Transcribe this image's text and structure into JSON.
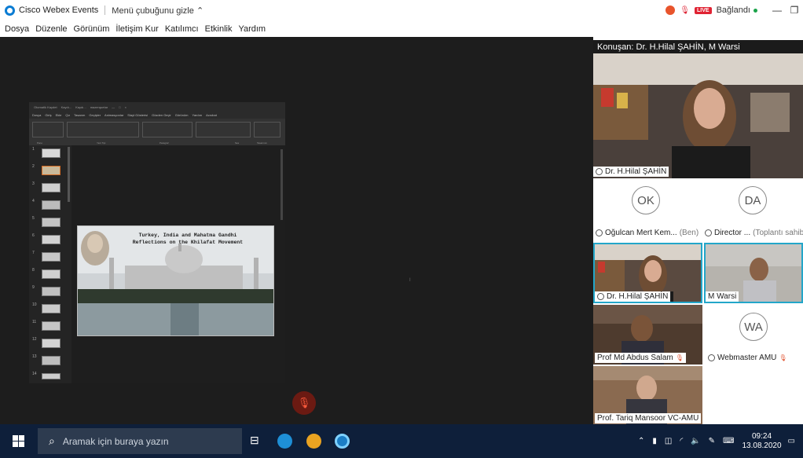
{
  "titlebar": {
    "app_title": "Cisco Webex Events",
    "hide_menu": "Menü çubuğunu gizle",
    "live": "LIVE",
    "connection": "Bağlandı",
    "minimize": "—",
    "restore": "❐"
  },
  "menu": {
    "items": [
      "Dosya",
      "Düzenle",
      "Görünüm",
      "İletişim Kur",
      "Katılımcı",
      "Etkinlik",
      "Yardım"
    ]
  },
  "ppt": {
    "top_items": [
      "Otomatik Kaydet",
      "Kaydı...",
      "Kaydı...",
      "mazerquetar",
      "—",
      "□",
      "×"
    ],
    "tabs": [
      "Dosya",
      "Giriş",
      "Ekle",
      "Çiz",
      "Tasarım",
      "Geçişler",
      "Animasyonlar",
      "Slayt Gösterisi",
      "Gözden Geçir",
      "Görünüm",
      "Yardım",
      "Acrobat"
    ],
    "group_labels": [
      "Pano",
      "Yazı Tipi",
      "Paragraf",
      "Ses",
      "Tasarımcı"
    ],
    "slide_numbers": [
      "1",
      "2",
      "3",
      "4",
      "5",
      "6",
      "7",
      "8",
      "9",
      "10",
      "11",
      "12",
      "13",
      "14"
    ],
    "slide_title_line1": "Turkey, India and Mahatma Gandhi",
    "slide_title_line2": "Reflections on the Khilafat Movement"
  },
  "panel": {
    "speaker": "Konuşan: Dr. H.Hilal ŞAHİN, M Warsi",
    "tiles": {
      "main_speaker_name": "Dr. H.Hilal ŞAHİN",
      "ok_initials": "OK",
      "ok_name": "Oğulcan Mert Kem...",
      "ok_suffix": "(Ben)",
      "da_initials": "DA",
      "da_name": "Director ...",
      "da_suffix": "(Toplantı sahibi)",
      "hilal_name": "Dr. H.Hilal ŞAHİN",
      "warsi_name": "M Warsi",
      "salam_name": "Prof Md Abdus Salam",
      "wa_initials": "WA",
      "wa_name": "Webmaster AMU",
      "tariq_name": "Prof. Tariq Mansoor VC-AMU"
    }
  },
  "taskbar": {
    "search_placeholder": "Aramak için buraya yazın",
    "time": "09:24",
    "date": "13.08.2020"
  },
  "colors": {
    "accent": "#0a7cd3",
    "selected_tile": "#23a6c9",
    "live_red": "#e02333",
    "taskbar": "#0e1f3a"
  }
}
